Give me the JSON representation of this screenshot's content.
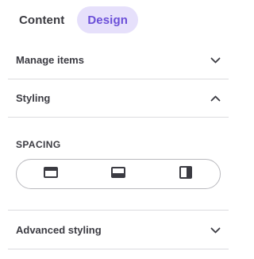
{
  "tabs": [
    {
      "label": "Content",
      "active": false
    },
    {
      "label": "Design",
      "active": true
    }
  ],
  "sections": {
    "manage_items": {
      "label": "Manage items",
      "state": "collapsed",
      "icon": "chevron-down-icon"
    },
    "styling": {
      "label": "Styling",
      "state": "expanded",
      "icon": "chevron-up-icon"
    },
    "advanced_styling": {
      "label": "Advanced styling",
      "state": "collapsed",
      "icon": "chevron-down-icon"
    }
  },
  "spacing": {
    "label": "SPACING",
    "options": [
      "spacing-top-icon",
      "spacing-bottom-icon",
      "spacing-sides-icon"
    ]
  },
  "colors": {
    "accent": "#6b4fd8",
    "accent_bg": "#e6e0fb",
    "divider": "#dcdcdf"
  }
}
